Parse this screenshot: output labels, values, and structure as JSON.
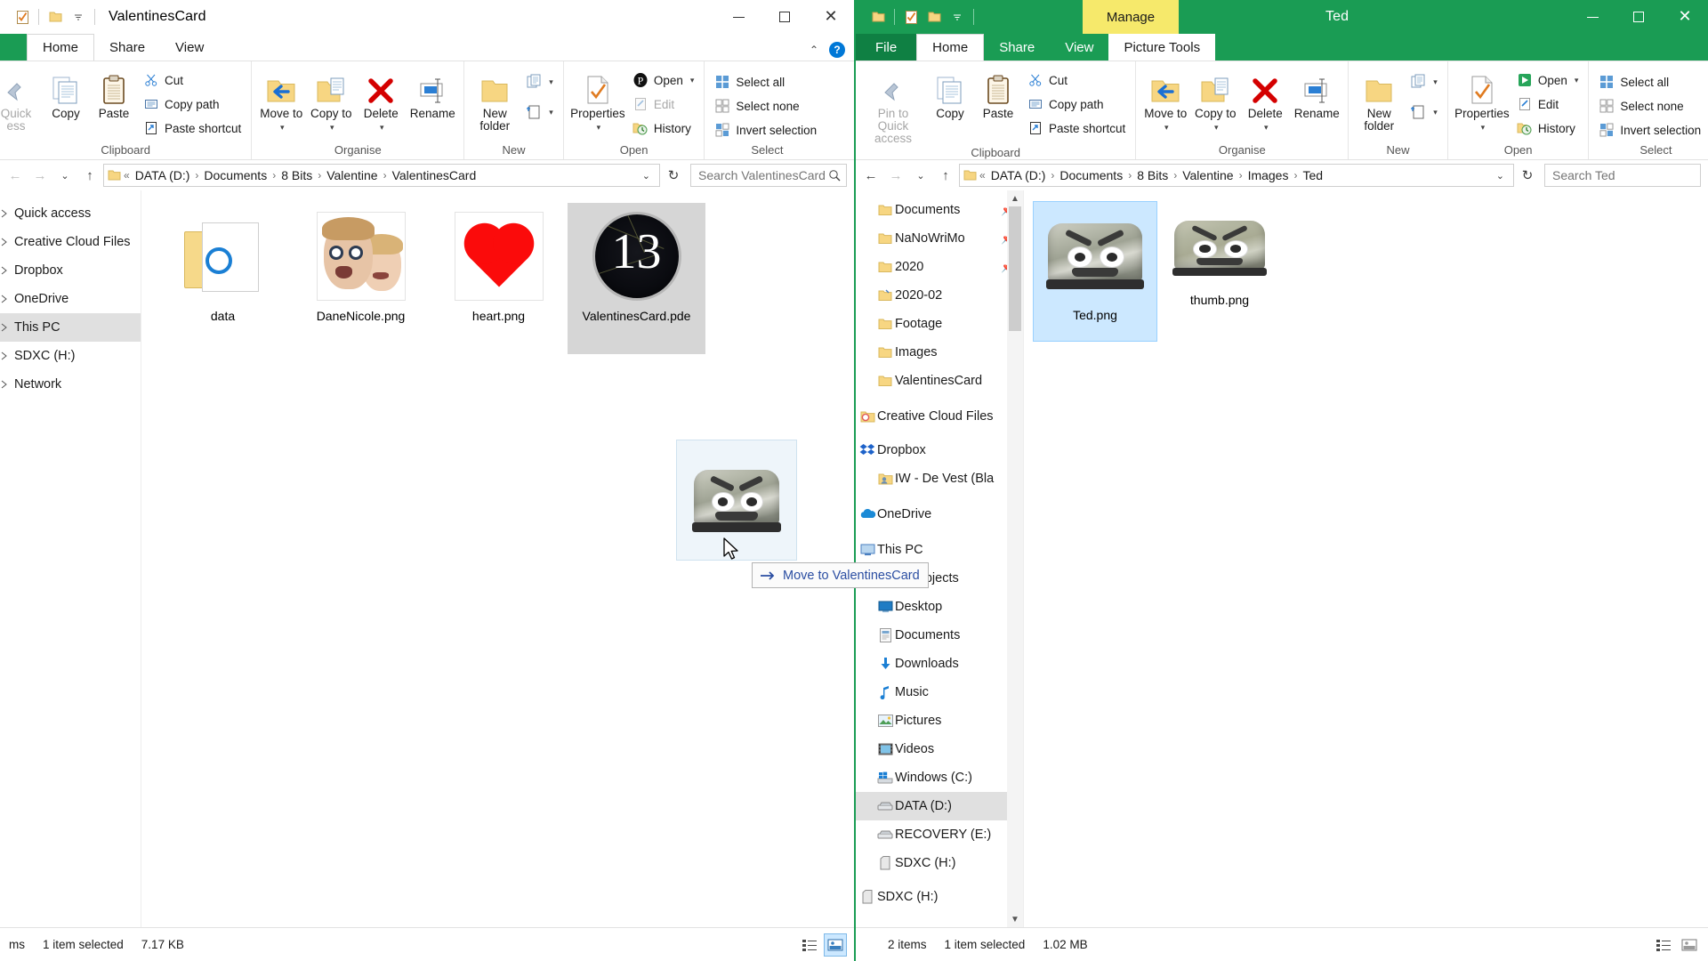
{
  "left_window": {
    "title": "ValentinesCard",
    "qat": [
      "checklist-icon",
      "folder-icon",
      "dropdown-icon"
    ],
    "window_controls": {
      "minimize": "minimize-icon",
      "maximize": "maximize-icon",
      "close": "close-icon"
    },
    "tabs": [
      {
        "label": "Home",
        "active": true
      },
      {
        "label": "Share",
        "active": false
      },
      {
        "label": "View",
        "active": false
      }
    ],
    "ribbon": {
      "groups": [
        {
          "label": "Clipboard",
          "big": [
            {
              "label": "Quick\naccess",
              "label_line1": "Quick",
              "label_line2": "ess",
              "icon": "pin-icon",
              "disabled": true
            },
            {
              "label": "Copy",
              "icon": "copy-icon",
              "disabled": false
            },
            {
              "label": "Paste",
              "icon": "paste-icon",
              "disabled": false
            }
          ],
          "small": [
            {
              "label": "Cut",
              "icon": "scissors-icon"
            },
            {
              "label": "Copy path",
              "icon": "copy-path-icon"
            },
            {
              "label": "Paste shortcut",
              "icon": "paste-shortcut-icon"
            }
          ]
        },
        {
          "label": "Organise",
          "big": [
            {
              "label": "Move to",
              "icon": "move-to-icon",
              "caret": true
            },
            {
              "label": "Copy to",
              "icon": "copy-to-icon",
              "caret": true
            },
            {
              "label": "Delete",
              "icon": "delete-icon",
              "caret": true
            },
            {
              "label": "Rename",
              "icon": "rename-icon",
              "caret": false
            }
          ]
        },
        {
          "label": "New",
          "big": [
            {
              "label": "New folder",
              "icon": "new-folder-icon"
            }
          ],
          "small": [
            {
              "label": "",
              "icon": "new-item-icon",
              "caret": true
            },
            {
              "label": "",
              "icon": "easy-access-icon",
              "caret": true
            }
          ]
        },
        {
          "label": "Open",
          "big": [
            {
              "label": "Properties",
              "icon": "properties-icon",
              "caret": true
            }
          ],
          "small": [
            {
              "label": "Open",
              "icon": "open-icon",
              "caret": true
            },
            {
              "label": "Edit",
              "icon": "edit-icon",
              "disabled": true
            },
            {
              "label": "History",
              "icon": "history-icon"
            }
          ]
        },
        {
          "label": "Select",
          "small": [
            {
              "label": "Select all",
              "icon": "select-all-icon"
            },
            {
              "label": "Select none",
              "icon": "select-none-icon"
            },
            {
              "label": "Invert selection",
              "icon": "invert-selection-icon"
            }
          ]
        }
      ]
    },
    "address": {
      "back": "back-arrow-icon",
      "forward": "forward-arrow-icon",
      "recent": "recent-dropdown-icon",
      "up": "up-arrow-icon",
      "crumbs": [
        "DATA (D:)",
        "Documents",
        "8 Bits",
        "Valentine",
        "ValentinesCard"
      ],
      "refresh": "refresh-icon",
      "search_placeholder": "Search ValentinesCard",
      "search_value": ""
    },
    "nav_items": [
      {
        "label": "Quick access",
        "icon": "star-icon",
        "indent": 0,
        "selected": false
      },
      {
        "label": "Creative Cloud Files",
        "icon": "creative-cloud-icon",
        "indent": 0,
        "selected": false
      },
      {
        "label": "Dropbox",
        "icon": "dropbox-icon",
        "indent": 0,
        "selected": false
      },
      {
        "label": "OneDrive",
        "icon": "onedrive-icon",
        "indent": 0,
        "selected": false
      },
      {
        "label": "This PC",
        "icon": "this-pc-icon",
        "indent": 0,
        "selected": true
      },
      {
        "label": "SDXC (H:)",
        "icon": "sdxc-icon",
        "indent": 0,
        "selected": false
      },
      {
        "label": "Network",
        "icon": "network-icon",
        "indent": 0,
        "selected": false
      }
    ],
    "files": [
      {
        "name": "data",
        "type": "folder",
        "selected": false
      },
      {
        "name": "DaneNicole.png",
        "type": "photo-faces",
        "selected": false
      },
      {
        "name": "heart.png",
        "type": "heart",
        "selected": false
      },
      {
        "name": "ValentinesCard.pde",
        "type": "pde",
        "selected": true
      }
    ],
    "status": {
      "count": "ms",
      "selected": "1 item selected",
      "size": "7.17 KB"
    }
  },
  "right_window": {
    "title": "Ted",
    "manage_tab": "Manage",
    "qat": [
      "folder-icon",
      "checklist-icon",
      "folder-icon",
      "dropdown-icon"
    ],
    "window_controls": {
      "minimize": "minimize-icon",
      "maximize": "maximize-icon",
      "close": "close-icon"
    },
    "tabs": [
      {
        "label": "File",
        "active": false,
        "kind": "file"
      },
      {
        "label": "Home",
        "active": true
      },
      {
        "label": "Share",
        "active": false
      },
      {
        "label": "View",
        "active": false
      },
      {
        "label": "Picture Tools",
        "active": false,
        "kind": "contextual"
      }
    ],
    "ribbon": {
      "groups": [
        {
          "label": "Clipboard",
          "big": [
            {
              "label_line1": "Pin to Quick",
              "label_line2": "access",
              "icon": "pin-icon",
              "disabled": true
            },
            {
              "label": "Copy",
              "icon": "copy-icon"
            },
            {
              "label": "Paste",
              "icon": "paste-icon"
            }
          ],
          "small": [
            {
              "label": "Cut",
              "icon": "scissors-icon"
            },
            {
              "label": "Copy path",
              "icon": "copy-path-icon"
            },
            {
              "label": "Paste shortcut",
              "icon": "paste-shortcut-icon"
            }
          ]
        },
        {
          "label": "Organise",
          "big": [
            {
              "label": "Move to",
              "icon": "move-to-icon",
              "caret": true
            },
            {
              "label": "Copy to",
              "icon": "copy-to-icon",
              "caret": true
            },
            {
              "label": "Delete",
              "icon": "delete-icon",
              "caret": true
            },
            {
              "label": "Rename",
              "icon": "rename-icon"
            }
          ]
        },
        {
          "label": "New",
          "big": [
            {
              "label": "New folder",
              "icon": "new-folder-icon"
            }
          ],
          "small": [
            {
              "label": "",
              "icon": "new-item-icon",
              "caret": true
            },
            {
              "label": "",
              "icon": "easy-access-icon",
              "caret": true
            }
          ]
        },
        {
          "label": "Open",
          "big": [
            {
              "label": "Properties",
              "icon": "properties-icon",
              "caret": true
            }
          ],
          "small": [
            {
              "label": "Open",
              "icon": "open-icon",
              "caret": true
            },
            {
              "label": "Edit",
              "icon": "edit-icon"
            },
            {
              "label": "History",
              "icon": "history-icon"
            }
          ]
        },
        {
          "label": "Select",
          "small": [
            {
              "label": "Select all",
              "icon": "select-all-icon"
            },
            {
              "label": "Select none",
              "icon": "select-none-icon"
            },
            {
              "label": "Invert selection",
              "icon": "invert-selection-icon"
            }
          ]
        }
      ]
    },
    "address": {
      "crumbs": [
        "DATA (D:)",
        "Documents",
        "8 Bits",
        "Valentine",
        "Images",
        "Ted"
      ],
      "search_placeholder": "Search Ted",
      "search_value": ""
    },
    "nav_items": [
      {
        "label": "Documents",
        "icon": "folder-icon",
        "indent": 1,
        "pinned": true
      },
      {
        "label": "NaNoWriMo",
        "icon": "folder-icon",
        "indent": 1,
        "pinned": true
      },
      {
        "label": "2020",
        "icon": "folder-icon",
        "indent": 1,
        "pinned": true
      },
      {
        "label": "2020-02",
        "icon": "folder-open-icon",
        "indent": 1,
        "pinned": false
      },
      {
        "label": "Footage",
        "icon": "folder-icon",
        "indent": 1,
        "pinned": false
      },
      {
        "label": "Images",
        "icon": "folder-icon",
        "indent": 1,
        "pinned": false
      },
      {
        "label": "ValentinesCard",
        "icon": "folder-icon",
        "indent": 1,
        "pinned": false
      },
      {
        "label": "Creative Cloud Files",
        "icon": "creative-cloud-icon",
        "indent": 0,
        "pinned": false
      },
      {
        "label": "Dropbox",
        "icon": "dropbox-icon",
        "indent": 0,
        "pinned": false
      },
      {
        "label": "IW - De Vest (Bla",
        "icon": "shared-folder-icon",
        "indent": 1,
        "pinned": false
      },
      {
        "label": "OneDrive",
        "icon": "onedrive-icon",
        "indent": 0,
        "pinned": false
      },
      {
        "label": "This PC",
        "icon": "this-pc-icon",
        "indent": 0,
        "pinned": false
      },
      {
        "label": "3D Objects",
        "icon": "3d-objects-icon",
        "indent": 1,
        "pinned": false
      },
      {
        "label": "Desktop",
        "icon": "desktop-icon",
        "indent": 1,
        "pinned": false
      },
      {
        "label": "Documents",
        "icon": "documents-icon",
        "indent": 1,
        "pinned": false
      },
      {
        "label": "Downloads",
        "icon": "downloads-icon",
        "indent": 1,
        "pinned": false
      },
      {
        "label": "Music",
        "icon": "music-icon",
        "indent": 1,
        "pinned": false
      },
      {
        "label": "Pictures",
        "icon": "pictures-icon",
        "indent": 1,
        "pinned": false
      },
      {
        "label": "Videos",
        "icon": "videos-icon",
        "indent": 1,
        "pinned": false
      },
      {
        "label": "Windows (C:)",
        "icon": "windows-drive-icon",
        "indent": 1,
        "pinned": false
      },
      {
        "label": "DATA (D:)",
        "icon": "drive-icon",
        "indent": 1,
        "selected": true
      },
      {
        "label": "RECOVERY (E:)",
        "icon": "drive-icon",
        "indent": 1,
        "pinned": false
      },
      {
        "label": "SDXC (H:)",
        "icon": "sdxc-icon",
        "indent": 1,
        "pinned": false
      },
      {
        "label": "SDXC (H:)",
        "icon": "sdxc-icon",
        "indent": 0,
        "pinned": false
      }
    ],
    "files": [
      {
        "name": "Ted.png",
        "type": "toaster",
        "selected": true
      },
      {
        "name": "thumb.png",
        "type": "toaster",
        "selected": false
      }
    ],
    "status": {
      "count": "2 items",
      "selected": "1 item selected",
      "size": "1.02 MB"
    }
  },
  "drag": {
    "tooltip_label": "Move to ValentinesCard",
    "tooltip_icon": "move-arrow-icon",
    "ghost_item": "Ted.png"
  },
  "colors": {
    "explorer_green": "#1a9c54",
    "file_tab_green": "#0f8043",
    "manage_yellow": "#f6e96b",
    "selection_blue": "#cce8ff",
    "accent_blue": "#0078d7",
    "heart_red": "#fb0b0b"
  }
}
